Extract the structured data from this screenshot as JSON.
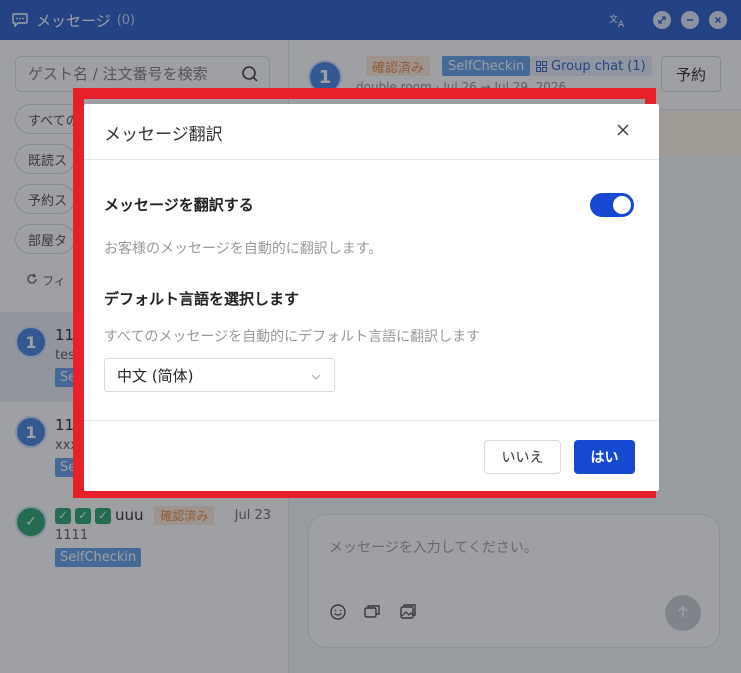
{
  "window": {
    "title": "メッセージ",
    "count": "(0)"
  },
  "sidebar": {
    "search_placeholder": "ゲスト名 / 注文番号を検索",
    "filters": [
      {
        "label": "すべての"
      },
      {
        "label": "既読ス"
      },
      {
        "label": "予約ス"
      },
      {
        "label": "部屋タ"
      }
    ],
    "reset_label": "フィ",
    "conversations": [
      {
        "avatar": "1",
        "name": "11",
        "sub": "tes",
        "tag": "Sel"
      },
      {
        "avatar": "1",
        "name": "11",
        "sub": "xxx",
        "tag": "Sel"
      },
      {
        "name": "uuu",
        "status": "確認済み",
        "date": "Jul 23",
        "sub": "1111",
        "tag": "SelfCheckin"
      }
    ]
  },
  "main": {
    "avatar": "1",
    "tags": {
      "confirmed": "確認済み",
      "selfcheckin": "SelfCheckin",
      "group_chat": "Group chat (1)"
    },
    "subline": "double room · Jul 26 → Jul 29, 2026",
    "reserve_button": "予約",
    "composer_placeholder": "メッセージを入力してください。"
  },
  "dialog": {
    "title": "メッセージ翻訳",
    "translate_label": "メッセージを翻訳する",
    "translate_enabled": true,
    "translate_desc": "お客様のメッセージを自動的に翻訳します。",
    "default_lang_label": "デフォルト言語を選択します",
    "default_lang_desc": "すべてのメッセージを自動的にデフォルト言語に翻訳します",
    "selected_language": "中文 (简体)",
    "cancel_label": "いいえ",
    "confirm_label": "はい"
  },
  "colors": {
    "titlebar": "#1f56c9",
    "primary": "#1549d1",
    "highlight": "#e8202a",
    "status_orange": "#e9833a",
    "tag_blue": "#5b9be8"
  }
}
